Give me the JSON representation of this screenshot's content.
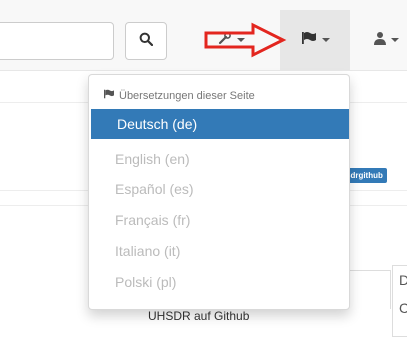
{
  "navbar": {
    "search_value": "",
    "search_icon": "search-icon",
    "tools_icon": "wrench-icon",
    "flag_icon": "flag-icon",
    "user_icon": "user-icon"
  },
  "annotation": {
    "arrow_color": "#e3261f"
  },
  "dropdown": {
    "header": "Übersetzungen dieser Seite",
    "items": [
      {
        "label": "Deutsch (de)",
        "active": true
      },
      {
        "label": "English (en)",
        "active": false
      },
      {
        "label": "Español (es)",
        "active": false
      },
      {
        "label": "Français (fr)",
        "active": false
      },
      {
        "label": "Italiano (it)",
        "active": false
      },
      {
        "label": "Polski (pl)",
        "active": false
      }
    ]
  },
  "page": {
    "badge": "sdrgithub",
    "side_letters": [
      "D",
      "C"
    ],
    "github_link": "UHSDR auf Github"
  },
  "colors": {
    "accent": "#337ab7",
    "navbar_bg": "#f8f8f8",
    "active_nav_bg": "#e7e7e7"
  }
}
